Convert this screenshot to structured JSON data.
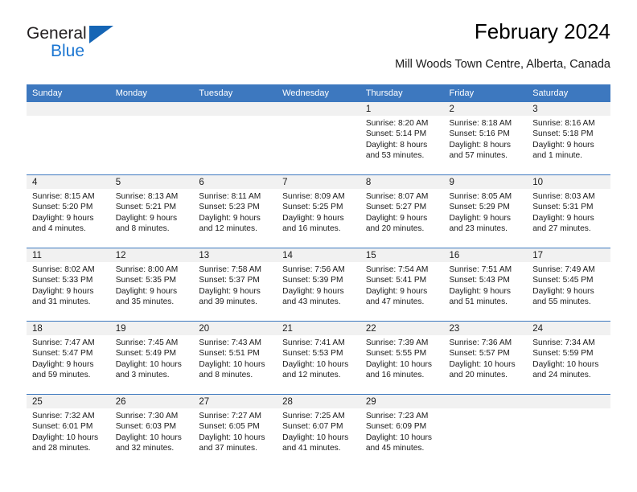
{
  "brand": {
    "name_top": "General",
    "name_bottom": "Blue",
    "triangle_color": "#1565b5",
    "blue_text_color": "#1b76d2"
  },
  "header": {
    "title": "February 2024",
    "subtitle": "Mill Woods Town Centre, Alberta, Canada"
  },
  "theme": {
    "accent": "#3d78bf",
    "daynum_band": "#f1f1f1",
    "text": "#1a1a1a"
  },
  "calendar": {
    "weekday_headers": [
      "Sunday",
      "Monday",
      "Tuesday",
      "Wednesday",
      "Thursday",
      "Friday",
      "Saturday"
    ],
    "weeks": [
      [
        {
          "day": "",
          "lines": []
        },
        {
          "day": "",
          "lines": []
        },
        {
          "day": "",
          "lines": []
        },
        {
          "day": "",
          "lines": []
        },
        {
          "day": "1",
          "lines": [
            "Sunrise: 8:20 AM",
            "Sunset: 5:14 PM",
            "Daylight: 8 hours",
            "and 53 minutes."
          ]
        },
        {
          "day": "2",
          "lines": [
            "Sunrise: 8:18 AM",
            "Sunset: 5:16 PM",
            "Daylight: 8 hours",
            "and 57 minutes."
          ]
        },
        {
          "day": "3",
          "lines": [
            "Sunrise: 8:16 AM",
            "Sunset: 5:18 PM",
            "Daylight: 9 hours",
            "and 1 minute."
          ]
        }
      ],
      [
        {
          "day": "4",
          "lines": [
            "Sunrise: 8:15 AM",
            "Sunset: 5:20 PM",
            "Daylight: 9 hours",
            "and 4 minutes."
          ]
        },
        {
          "day": "5",
          "lines": [
            "Sunrise: 8:13 AM",
            "Sunset: 5:21 PM",
            "Daylight: 9 hours",
            "and 8 minutes."
          ]
        },
        {
          "day": "6",
          "lines": [
            "Sunrise: 8:11 AM",
            "Sunset: 5:23 PM",
            "Daylight: 9 hours",
            "and 12 minutes."
          ]
        },
        {
          "day": "7",
          "lines": [
            "Sunrise: 8:09 AM",
            "Sunset: 5:25 PM",
            "Daylight: 9 hours",
            "and 16 minutes."
          ]
        },
        {
          "day": "8",
          "lines": [
            "Sunrise: 8:07 AM",
            "Sunset: 5:27 PM",
            "Daylight: 9 hours",
            "and 20 minutes."
          ]
        },
        {
          "day": "9",
          "lines": [
            "Sunrise: 8:05 AM",
            "Sunset: 5:29 PM",
            "Daylight: 9 hours",
            "and 23 minutes."
          ]
        },
        {
          "day": "10",
          "lines": [
            "Sunrise: 8:03 AM",
            "Sunset: 5:31 PM",
            "Daylight: 9 hours",
            "and 27 minutes."
          ]
        }
      ],
      [
        {
          "day": "11",
          "lines": [
            "Sunrise: 8:02 AM",
            "Sunset: 5:33 PM",
            "Daylight: 9 hours",
            "and 31 minutes."
          ]
        },
        {
          "day": "12",
          "lines": [
            "Sunrise: 8:00 AM",
            "Sunset: 5:35 PM",
            "Daylight: 9 hours",
            "and 35 minutes."
          ]
        },
        {
          "day": "13",
          "lines": [
            "Sunrise: 7:58 AM",
            "Sunset: 5:37 PM",
            "Daylight: 9 hours",
            "and 39 minutes."
          ]
        },
        {
          "day": "14",
          "lines": [
            "Sunrise: 7:56 AM",
            "Sunset: 5:39 PM",
            "Daylight: 9 hours",
            "and 43 minutes."
          ]
        },
        {
          "day": "15",
          "lines": [
            "Sunrise: 7:54 AM",
            "Sunset: 5:41 PM",
            "Daylight: 9 hours",
            "and 47 minutes."
          ]
        },
        {
          "day": "16",
          "lines": [
            "Sunrise: 7:51 AM",
            "Sunset: 5:43 PM",
            "Daylight: 9 hours",
            "and 51 minutes."
          ]
        },
        {
          "day": "17",
          "lines": [
            "Sunrise: 7:49 AM",
            "Sunset: 5:45 PM",
            "Daylight: 9 hours",
            "and 55 minutes."
          ]
        }
      ],
      [
        {
          "day": "18",
          "lines": [
            "Sunrise: 7:47 AM",
            "Sunset: 5:47 PM",
            "Daylight: 9 hours",
            "and 59 minutes."
          ]
        },
        {
          "day": "19",
          "lines": [
            "Sunrise: 7:45 AM",
            "Sunset: 5:49 PM",
            "Daylight: 10 hours",
            "and 3 minutes."
          ]
        },
        {
          "day": "20",
          "lines": [
            "Sunrise: 7:43 AM",
            "Sunset: 5:51 PM",
            "Daylight: 10 hours",
            "and 8 minutes."
          ]
        },
        {
          "day": "21",
          "lines": [
            "Sunrise: 7:41 AM",
            "Sunset: 5:53 PM",
            "Daylight: 10 hours",
            "and 12 minutes."
          ]
        },
        {
          "day": "22",
          "lines": [
            "Sunrise: 7:39 AM",
            "Sunset: 5:55 PM",
            "Daylight: 10 hours",
            "and 16 minutes."
          ]
        },
        {
          "day": "23",
          "lines": [
            "Sunrise: 7:36 AM",
            "Sunset: 5:57 PM",
            "Daylight: 10 hours",
            "and 20 minutes."
          ]
        },
        {
          "day": "24",
          "lines": [
            "Sunrise: 7:34 AM",
            "Sunset: 5:59 PM",
            "Daylight: 10 hours",
            "and 24 minutes."
          ]
        }
      ],
      [
        {
          "day": "25",
          "lines": [
            "Sunrise: 7:32 AM",
            "Sunset: 6:01 PM",
            "Daylight: 10 hours",
            "and 28 minutes."
          ]
        },
        {
          "day": "26",
          "lines": [
            "Sunrise: 7:30 AM",
            "Sunset: 6:03 PM",
            "Daylight: 10 hours",
            "and 32 minutes."
          ]
        },
        {
          "day": "27",
          "lines": [
            "Sunrise: 7:27 AM",
            "Sunset: 6:05 PM",
            "Daylight: 10 hours",
            "and 37 minutes."
          ]
        },
        {
          "day": "28",
          "lines": [
            "Sunrise: 7:25 AM",
            "Sunset: 6:07 PM",
            "Daylight: 10 hours",
            "and 41 minutes."
          ]
        },
        {
          "day": "29",
          "lines": [
            "Sunrise: 7:23 AM",
            "Sunset: 6:09 PM",
            "Daylight: 10 hours",
            "and 45 minutes."
          ]
        },
        {
          "day": "",
          "lines": []
        },
        {
          "day": "",
          "lines": []
        }
      ]
    ]
  }
}
